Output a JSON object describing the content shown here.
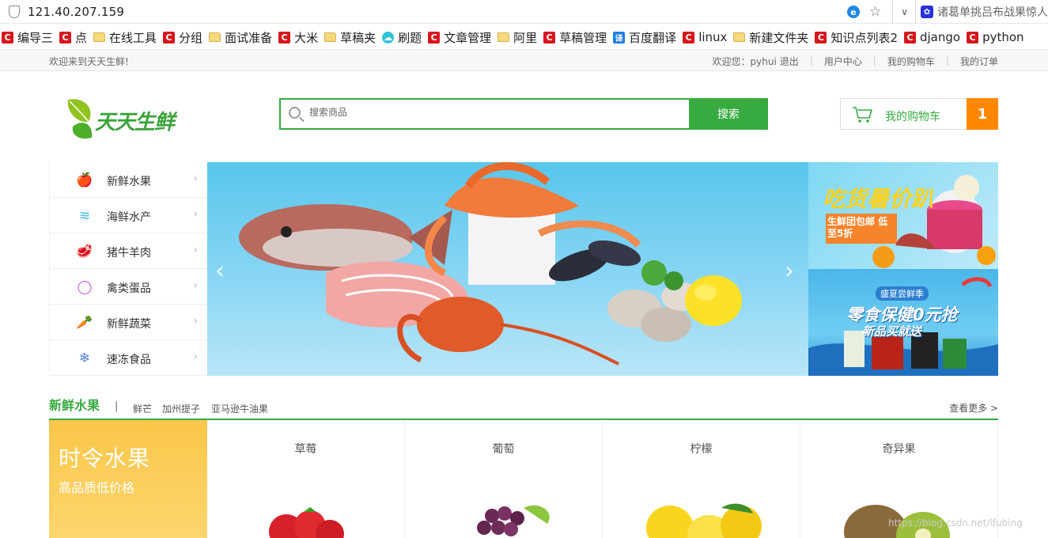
{
  "browser": {
    "url": "121.40.207.159",
    "news_snippet": "诸葛单挑吕布战果惊人",
    "bookmarks": [
      {
        "label": "编导三",
        "icon": "c"
      },
      {
        "label": "点",
        "icon": "c"
      },
      {
        "label": "在线工具",
        "icon": "folder"
      },
      {
        "label": "分组",
        "icon": "c"
      },
      {
        "label": "面试准备",
        "icon": "folder"
      },
      {
        "label": "大米",
        "icon": "c"
      },
      {
        "label": "草稿夹",
        "icon": "folder"
      },
      {
        "label": "刷题",
        "icon": "cloud"
      },
      {
        "label": "文章管理",
        "icon": "c"
      },
      {
        "label": "阿里",
        "icon": "folder"
      },
      {
        "label": "草稿管理",
        "icon": "c"
      },
      {
        "label": "百度翻译",
        "icon": "yi"
      },
      {
        "label": "linux",
        "icon": "c"
      },
      {
        "label": "新建文件夹",
        "icon": "folder"
      },
      {
        "label": "知识点列表2",
        "icon": "c"
      },
      {
        "label": "django",
        "icon": "c"
      },
      {
        "label": "python",
        "icon": "c"
      }
    ]
  },
  "top_strip": {
    "welcome": "欢迎来到天天生鲜!",
    "user_greeting": "欢迎您：pyhui",
    "logout": "退出",
    "user_center": "用户中心",
    "my_cart": "我的购物车",
    "my_orders": "我的订单"
  },
  "header": {
    "logo_text": "天天生鲜",
    "search_placeholder": "搜索商品",
    "search_button": "搜索",
    "cart_label": "我的购物车",
    "cart_count": "1"
  },
  "categories": [
    {
      "label": "新鲜水果",
      "icon": "apple-icon",
      "glyph": "🍎"
    },
    {
      "label": "海鲜水产",
      "icon": "fish-icon",
      "glyph": "≋"
    },
    {
      "label": "猪牛羊肉",
      "icon": "meat-icon",
      "glyph": "🥩"
    },
    {
      "label": "禽类蛋品",
      "icon": "egg-icon",
      "glyph": "◯"
    },
    {
      "label": "新鲜蔬菜",
      "icon": "carrot-icon",
      "glyph": "🥕"
    },
    {
      "label": "速冻食品",
      "icon": "snowflake-icon",
      "glyph": "❄"
    }
  ],
  "ads": {
    "ad1_title": "吃货暑价趴",
    "ad1_sub": "生鲜团包邮 低至5折",
    "ad2_tag": "盛夏尝鲜季",
    "ad2_title": "零食保健0元抢",
    "ad2_sub": "新品买就送"
  },
  "section": {
    "title": "新鲜水果",
    "divider": "|",
    "subs": [
      "鲜芒",
      "加州提子",
      "亚马逊牛油果"
    ],
    "more": "查看更多 >",
    "promo_title": "时令水果",
    "promo_sub": "高品质低价格",
    "goods": [
      {
        "name": "草莓",
        "icon": "strawberry-image"
      },
      {
        "name": "葡萄",
        "icon": "grape-image"
      },
      {
        "name": "柠檬",
        "icon": "lemon-image"
      },
      {
        "name": "奇异果",
        "icon": "kiwi-image"
      }
    ]
  },
  "watermark": "https://blog.csdn.net/lfubing",
  "colors": {
    "brand_green": "#37ab40",
    "cart_orange": "#ff8800",
    "promo_yellow": "#fbc649"
  }
}
